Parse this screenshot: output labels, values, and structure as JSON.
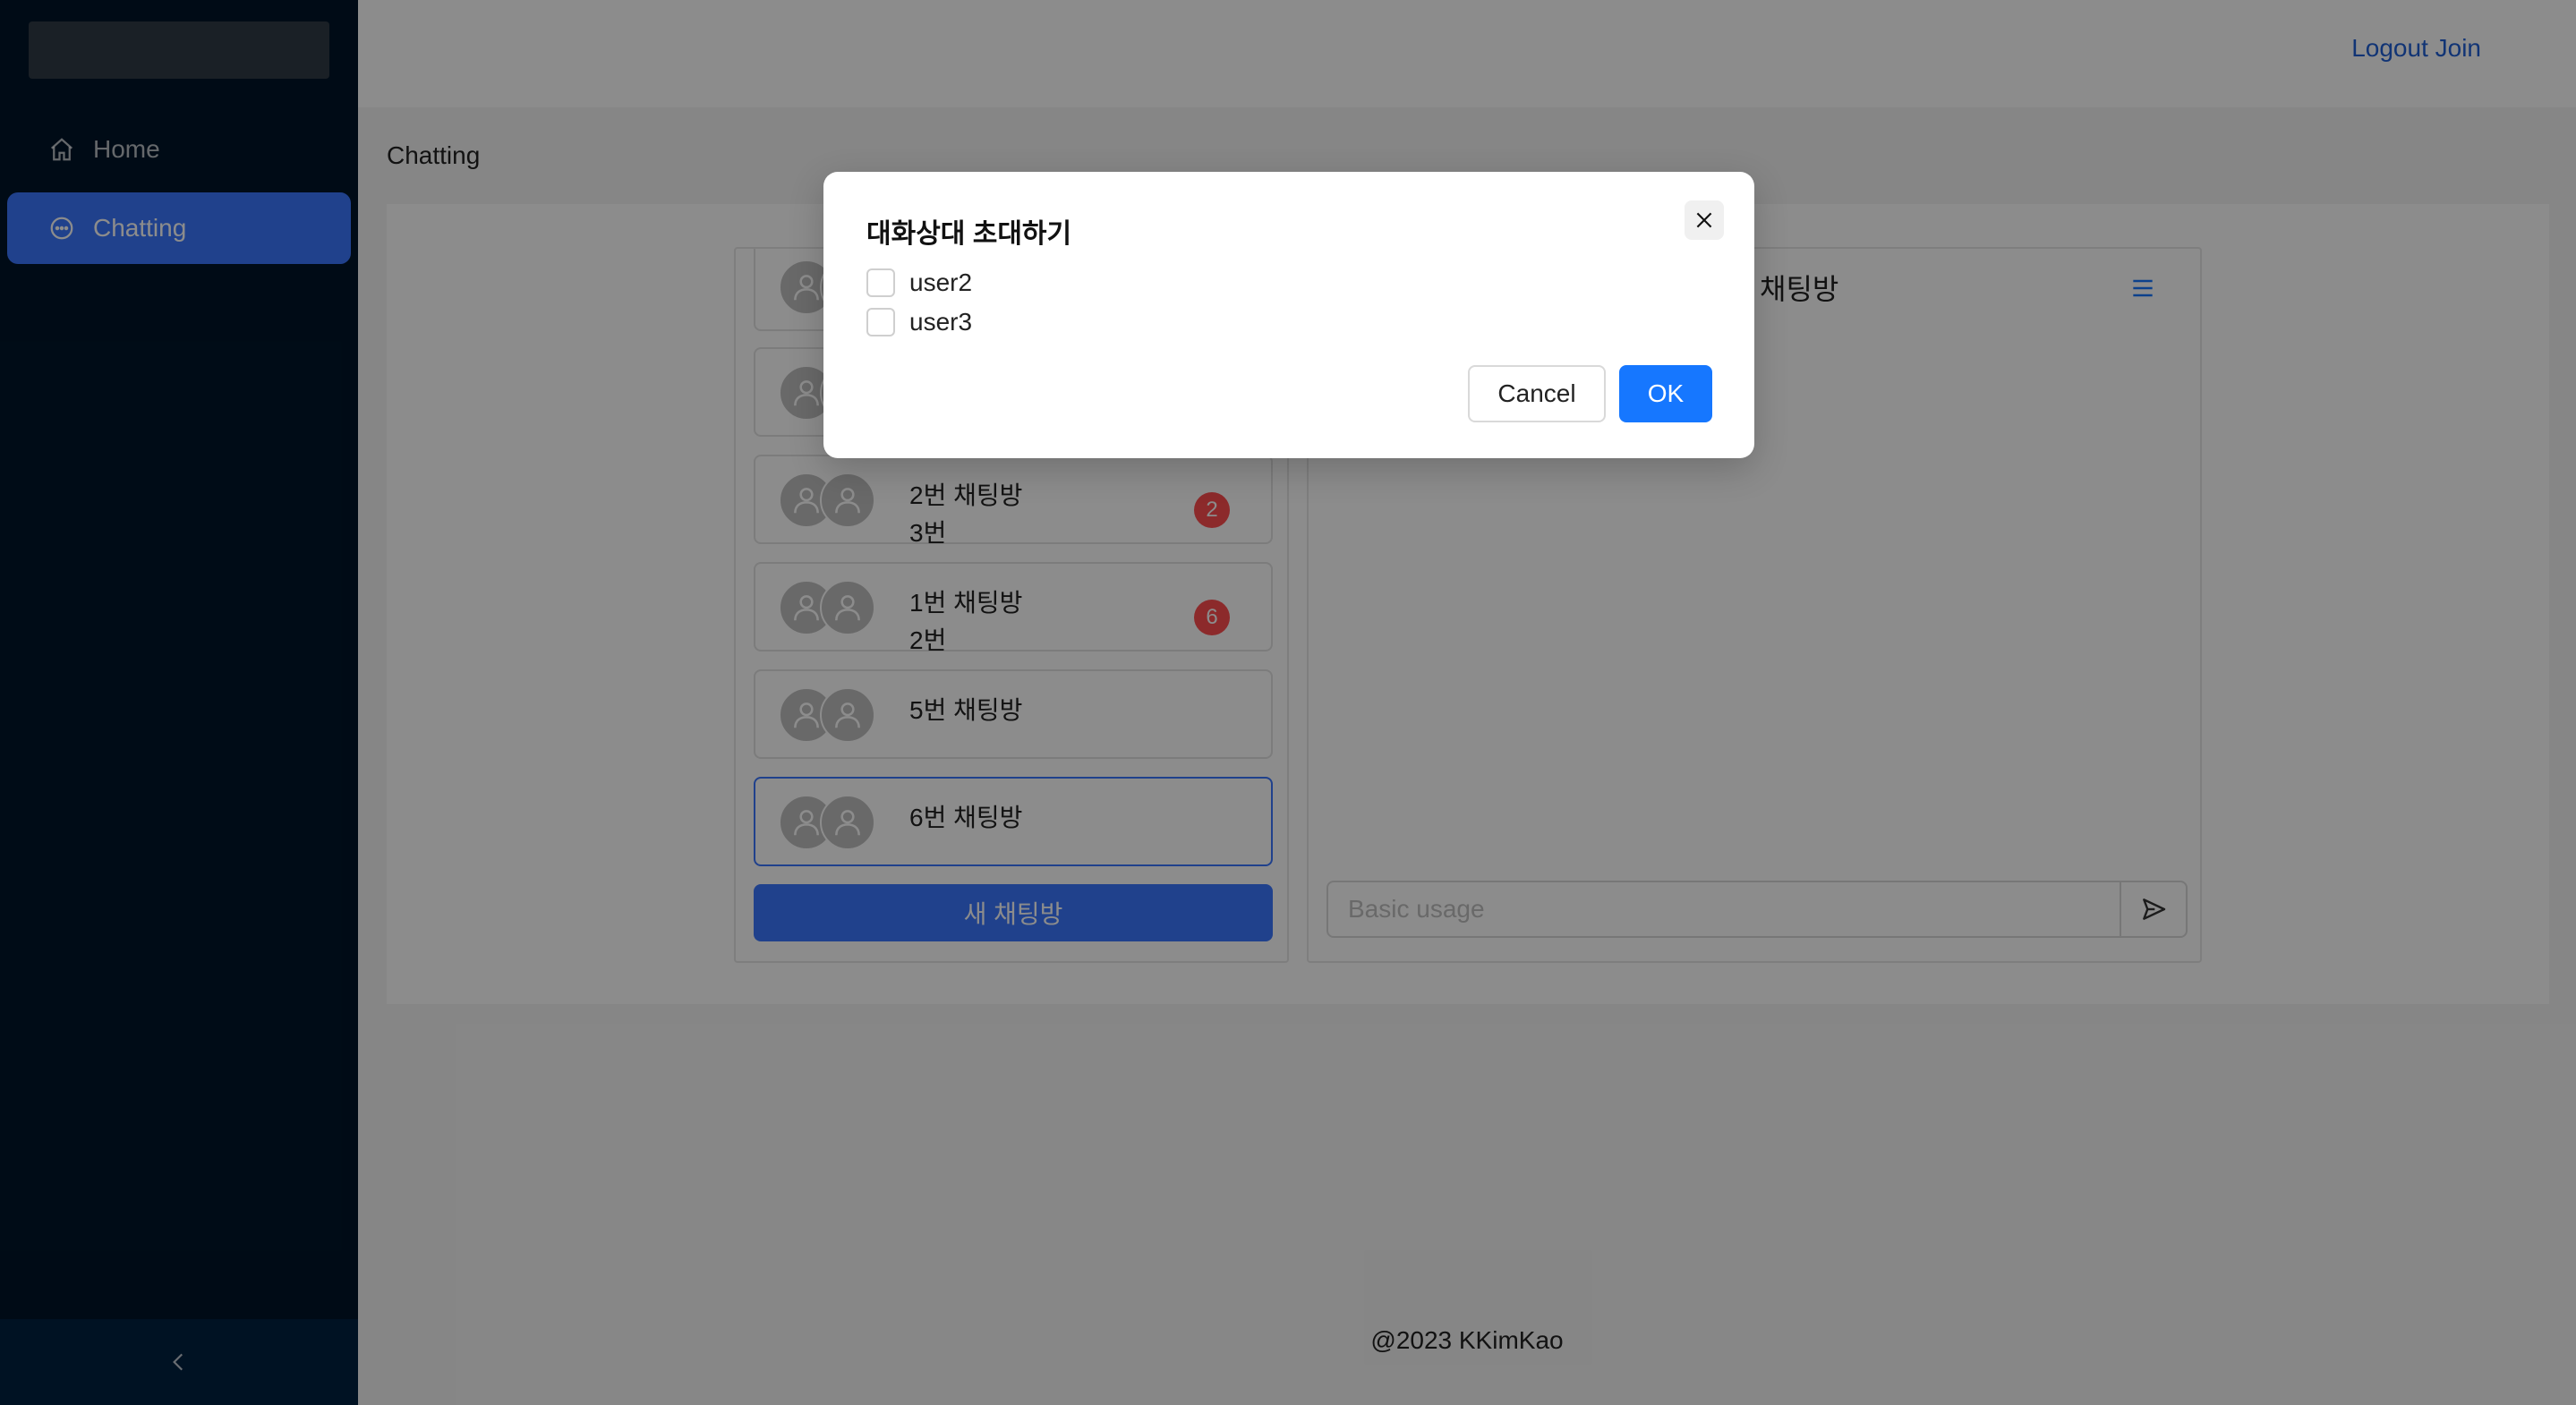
{
  "sidebar": {
    "items": [
      {
        "label": "Home",
        "icon": "home-icon"
      },
      {
        "label": "Chatting",
        "icon": "chat-icon",
        "active": true
      }
    ],
    "collapse_icon": "chevron-left-icon"
  },
  "header": {
    "links": "Logout Join"
  },
  "breadcrumb": "Chatting",
  "rooms": [
    {
      "name": "",
      "sub": ""
    },
    {
      "name": "",
      "sub": ""
    },
    {
      "name": "2번 채팅방",
      "sub": "3번",
      "badge": "2"
    },
    {
      "name": "1번 채팅방",
      "sub": "2번",
      "badge": "6"
    },
    {
      "name": "5번 채팅방",
      "sub": ""
    },
    {
      "name": "6번 채팅방",
      "sub": "",
      "selected": true
    }
  ],
  "new_room_label": "새 채팅방",
  "chat": {
    "title": "채팅방",
    "input_placeholder": "Basic usage"
  },
  "footer": "@2023 KKimKao",
  "modal": {
    "title": "대화상대 초대하기",
    "options": [
      "user2",
      "user3"
    ],
    "cancel_label": "Cancel",
    "ok_label": "OK"
  },
  "colors": {
    "primary": "#1677ff",
    "sidebar_bg": "#001529",
    "badge": "#ff4d4f"
  }
}
